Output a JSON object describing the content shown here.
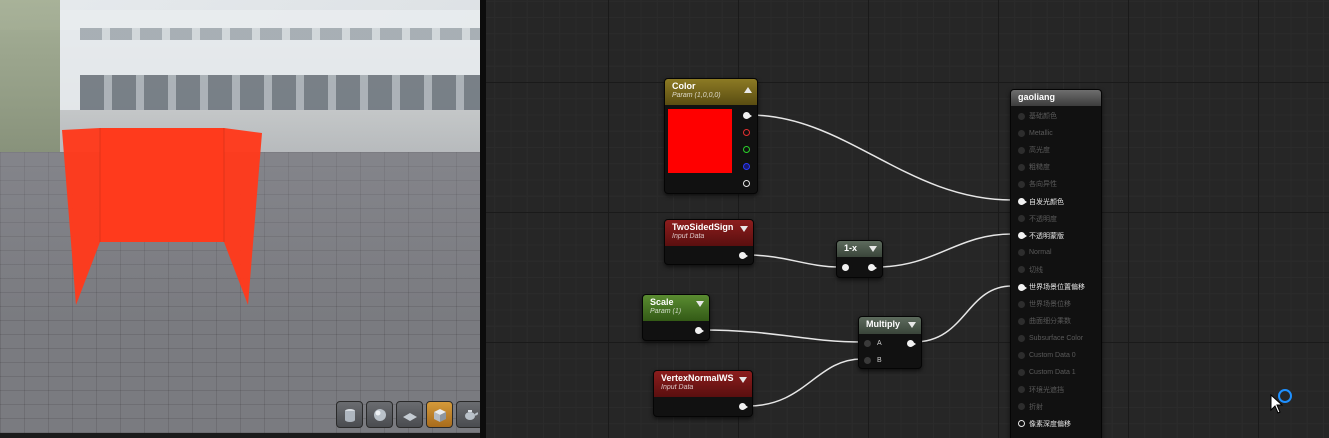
{
  "viewport": {
    "toolbar": [
      {
        "name": "cylinder-preview-button",
        "icon": "cylinder-icon",
        "active": false
      },
      {
        "name": "sphere-preview-button",
        "icon": "sphere-icon",
        "active": false
      },
      {
        "name": "plane-preview-button",
        "icon": "plane-icon",
        "active": false
      },
      {
        "name": "cube-preview-button",
        "icon": "cube-icon",
        "active": true
      },
      {
        "name": "custom-mesh-preview-button",
        "icon": "teapot-icon",
        "active": false
      }
    ],
    "mesh_color": "#ff3a1c"
  },
  "nodes": {
    "color": {
      "title": "Color",
      "subtitle": "Param (1,0,0,0)",
      "swatch": "#ff0000",
      "header_color": "#7a6a1e"
    },
    "twosided": {
      "title": "TwoSidedSign",
      "subtitle": "Input Data",
      "header_color": "#7a1818"
    },
    "oneminus": {
      "title": "1-x",
      "header_color": "#4e5a4e"
    },
    "scale": {
      "title": "Scale",
      "subtitle": "Param (1)",
      "header_color": "#4d7a2a"
    },
    "multiply": {
      "title": "Multiply",
      "input_a": "A",
      "input_b": "B",
      "header_color": "#4e5a4e"
    },
    "vertexnormal": {
      "title": "VertexNormalWS",
      "subtitle": "Input Data",
      "header_color": "#7a1818"
    }
  },
  "output": {
    "title": "gaoliang",
    "pins": [
      {
        "label": "基础颜色",
        "state": "off"
      },
      {
        "label": "Metallic",
        "state": "off"
      },
      {
        "label": "高光度",
        "state": "off"
      },
      {
        "label": "粗糙度",
        "state": "off"
      },
      {
        "label": "各向异性",
        "state": "off"
      },
      {
        "label": "自发光颜色",
        "state": "on"
      },
      {
        "label": "不透明度",
        "state": "off"
      },
      {
        "label": "不透明蒙版",
        "state": "on"
      },
      {
        "label": "Normal",
        "state": "off"
      },
      {
        "label": "切线",
        "state": "off"
      },
      {
        "label": "世界场景位置偏移",
        "state": "on"
      },
      {
        "label": "世界场景位移",
        "state": "off"
      },
      {
        "label": "曲面细分乘数",
        "state": "off"
      },
      {
        "label": "Subsurface Color",
        "state": "off"
      },
      {
        "label": "Custom Data 0",
        "state": "off"
      },
      {
        "label": "Custom Data 1",
        "state": "off"
      },
      {
        "label": "环境光遮挡",
        "state": "off"
      },
      {
        "label": "折射",
        "state": "off"
      },
      {
        "label": "像素深度偏移",
        "state": "outline"
      }
    ]
  }
}
